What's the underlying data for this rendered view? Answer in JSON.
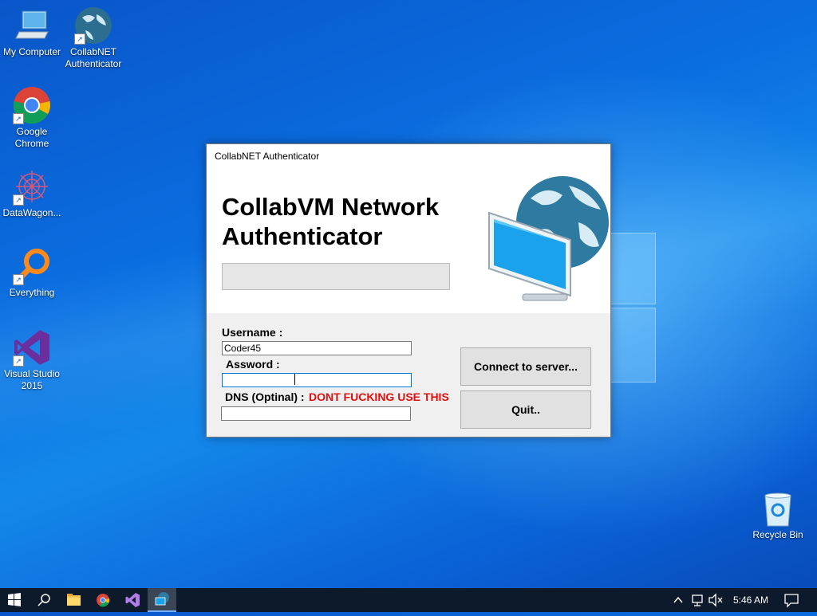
{
  "desktop": {
    "icons": [
      {
        "label": "My Computer"
      },
      {
        "label": "CollabNET Authenticator"
      },
      {
        "label": "Google Chrome"
      },
      {
        "label": "DataWagon..."
      },
      {
        "label": "Everything"
      },
      {
        "label": "Visual Studio 2015"
      },
      {
        "label": "Recycle Bin"
      }
    ]
  },
  "dialog": {
    "window_title": "CollabNET Authenticator",
    "heading_line1": "CollabVM Network",
    "heading_line2": "Authenticator",
    "username_label": "Username :",
    "username_value": "Coder45",
    "password_label": "Assword :",
    "password_value": "",
    "dns_label": "DNS (Optinal) :",
    "dns_warning": "DONT FUCKING USE THIS",
    "dns_value": "",
    "connect_button": "Connect to server...",
    "quit_button": "Quit.."
  },
  "taskbar": {
    "clock": "5:46 AM",
    "pinned": [
      "start-icon",
      "search-icon",
      "file-explorer-icon",
      "chrome-icon",
      "visual-studio-icon",
      "collabnet-icon"
    ]
  },
  "colors": {
    "warning": "#e01010",
    "focus_border": "#0078d7",
    "taskbar": "#0d1a2b"
  }
}
